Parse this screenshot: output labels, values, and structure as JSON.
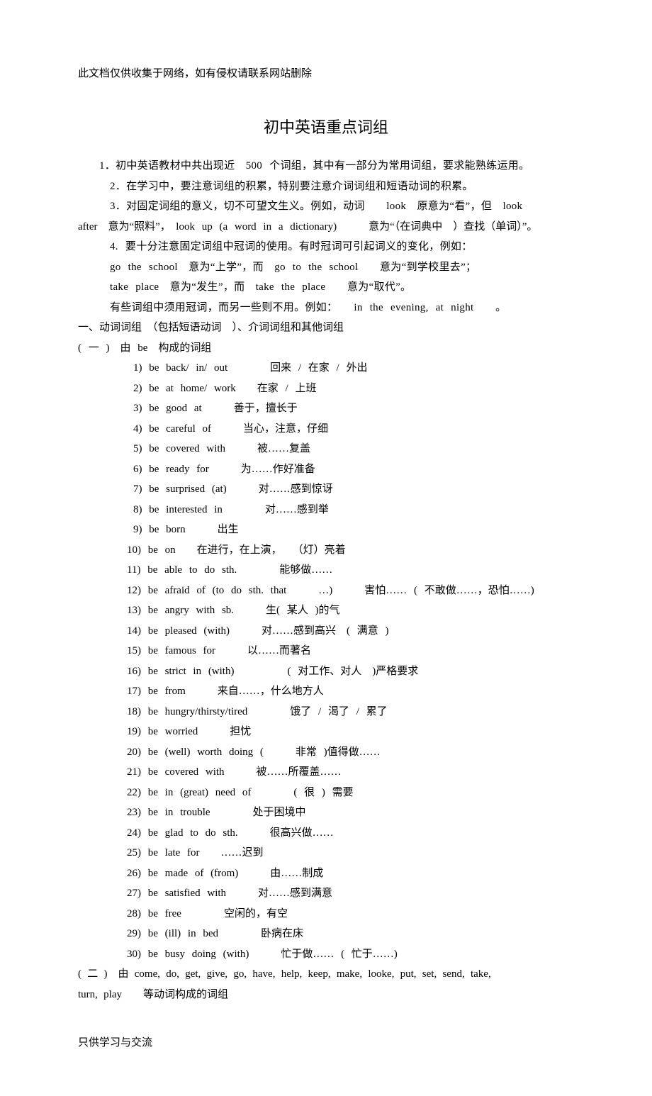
{
  "header_note": "此文档仅供收集于网络，如有侵权请联系网站删除",
  "title": "初中英语重点词组",
  "intro": [
    "1．初中英语教材中共出现近　500 个词组，其中有一部分为常用词组，要求能熟练运用。",
    "2．在学习中，要注意词组的积累，特别要注意介词词组和短语动词的积累。",
    "3．对固定词组的意义，切不可望文生义。例如，动词　　look　原意为“看”，但　look",
    "4. 要十分注意固定词组中冠词的使用。有时冠词可引起词义的变化，例如：",
    "go the school　意为“上学”，而　go to the school　　意为“到学校里去”；",
    "take place　意为“发生”，而　take the place　　意为“取代”。",
    "有些词组中须用冠词，而另一些则不用。例如：　　in the evening, at night　　。"
  ],
  "intro_line_after": "after　意为“照料”，　look up (a word in a dictionary)　　　意为“（在词典中　）查找（单词）”。",
  "section1_title": "一、动词词组　（包括短语动词　）、介词词组和其他词组",
  "section1_sub": "( 一 )　由 be　构成的词组",
  "be_items": [
    "1) be back/ in/ out　　　　回来 / 在家 / 外出",
    "2) be at home/ work　　在家 / 上班",
    "3) be good at　　　善于，擅长于",
    "4) be careful of　　　当心，注意，仔细",
    "5) be covered with　　　被……复盖",
    "6) be ready for　　　为……作好准备",
    "7) be surprised (at)　　　对……感到惊讶",
    "8) be interested in　　　　对……感到举",
    "9) be born　　　出生",
    "10) be on　　在进行，在上演，　　（灯）亮着",
    "11) be able to do sth.　　　　能够做……",
    " 12) be afraid of (to do sth. that　　　…)　　　害怕…… ( 不敢做……，恐怕……)",
    "13) be angry with sb.　　　生( 某人 )的气",
    "14) be pleased (with)　　　对……感到高兴　( 满意 )",
    "15) be famous for　　　以……而著名",
    "16) be strict in (with)　　　　　( 对工作、对人　)严格要求",
    "17) be from　　　来自……，什么地方人",
    "18) be hungry/thirsty/tired　　　　饿了 / 渴了 / 累了",
    "19) be worried　　　担忧",
    "20) be (well) worth doing (　　　非常 )值得做……",
    "21) be covered with　　　被……所覆盖……",
    "22) be in (great) need of　　　　( 很 ) 需要",
    "23) be in trouble　　　　处于困境中",
    "24) be glad to do sth.　　　很高兴做……",
    " 25) be late for　　……迟到",
    "26) be made of (from)　　　由……制成",
    "27) be satisfied with　　　对……感到满意",
    "28) be free　　　　空闲的，有空",
    "29) be (ill) in bed　　　　卧病在床",
    "30) be busy doing (with)　　　忙于做…… ( 忙于……)"
  ],
  "section2_a": "( 二 )　由 come, do, get, give, go, have, help, keep, make, looke, put, set, send, take,",
  "section2_b": "turn, play　　等动词构成的词组",
  "footer_note": "只供学习与交流"
}
